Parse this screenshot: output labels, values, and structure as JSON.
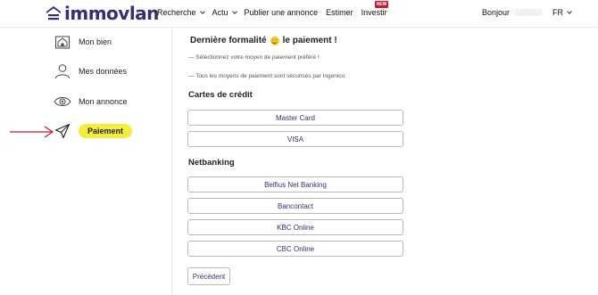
{
  "header": {
    "logo_text": "immovlan",
    "nav": [
      "Recherche",
      "Actu",
      "Publier une annonce",
      "Estimer",
      "Investir"
    ],
    "new_badge": "NEW",
    "greeting": "Bonjour",
    "language": "FR",
    "brand_color": "#3d2c74"
  },
  "sidebar": {
    "items": [
      {
        "label": "Mon bien",
        "icon": "house-icon"
      },
      {
        "label": "Mes données",
        "icon": "user-icon"
      },
      {
        "label": "Mon annonce",
        "icon": "eye-icon"
      },
      {
        "label": "Paiement",
        "icon": "send-icon",
        "highlighted": true
      }
    ],
    "highlight_color": "#f4ee3a",
    "annotation_color": "#d0162b"
  },
  "main": {
    "title_before": "Dernière formalité",
    "title_after": "le paiement !",
    "note_1": "— Sélectionnez votre moyen de paiement préféré !",
    "note_2": "— Tous les moyens de paiement sont sécurisés par Ingenico.",
    "credit_title": "Cartes de crédit",
    "credit_options": [
      "Master Card",
      "VISA"
    ],
    "netbanking_title": "Netbanking",
    "netbanking_options": [
      "Belfius Net Banking",
      "Bancontact",
      "KBC Online",
      "CBC Online"
    ],
    "previous_label": "Précédent"
  }
}
